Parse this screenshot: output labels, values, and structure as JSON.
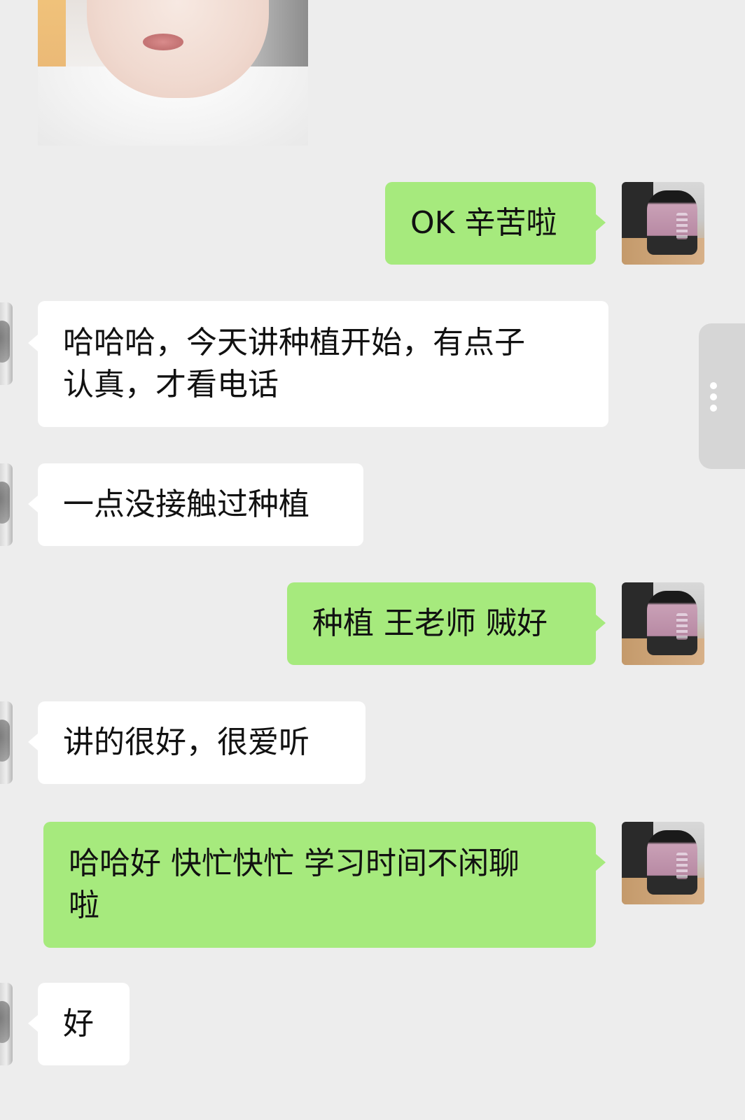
{
  "messages": [
    {
      "side": "left",
      "type": "image",
      "content": "photo"
    },
    {
      "side": "right",
      "text": "OK 辛苦啦"
    },
    {
      "side": "left",
      "text_lines": [
        "哈哈哈，今天讲种植开始，有点子",
        "认真，才看电话"
      ]
    },
    {
      "side": "left",
      "text": "一点没接触过种植"
    },
    {
      "side": "right",
      "text": "种植 王老师 贼好"
    },
    {
      "side": "left",
      "text": "讲的很好，很爱听"
    },
    {
      "side": "right",
      "text_lines": [
        "哈哈好 快忙快忙 学习时间不闲聊",
        "啦"
      ]
    },
    {
      "side": "left",
      "text": "好"
    }
  ],
  "colors": {
    "background": "#ededed",
    "bubble_left": "#ffffff",
    "bubble_right": "#a6ea7d",
    "text": "#111111"
  },
  "icons": {
    "more": "more-vertical-icon"
  }
}
